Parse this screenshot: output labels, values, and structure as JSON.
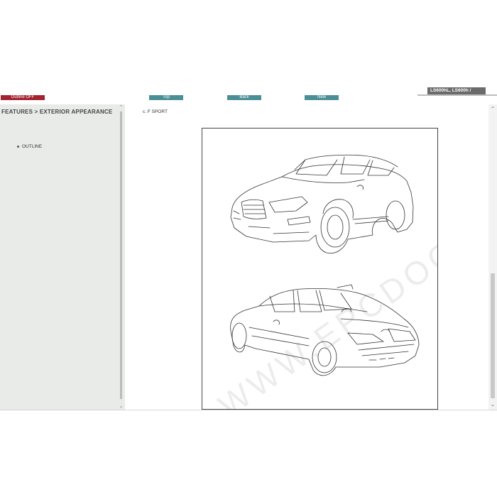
{
  "toolbar": {
    "outline_label": "Outline OFF",
    "top_label": "Top",
    "back_label": "Back",
    "new_label": "New"
  },
  "model_tab": "LS600hL, LS600h /",
  "sidebar": {
    "title": "FEATURES > EXTERIOR APPEARANCE",
    "items": [
      {
        "label": "OUTLINE"
      }
    ]
  },
  "content": {
    "section_label": "c.  F SPORT",
    "watermark": "WWW.EPCDOC.COM"
  },
  "colors": {
    "outline_button": "#a32330",
    "nav_button": "#4b8f96",
    "sidebar_bg": "#e8ebe8",
    "model_tab_bg": "#6b6b6b"
  },
  "icons": [
    "scroll-up-arrow-icon",
    "scroll-down-arrow-icon",
    "bullet-icon"
  ]
}
